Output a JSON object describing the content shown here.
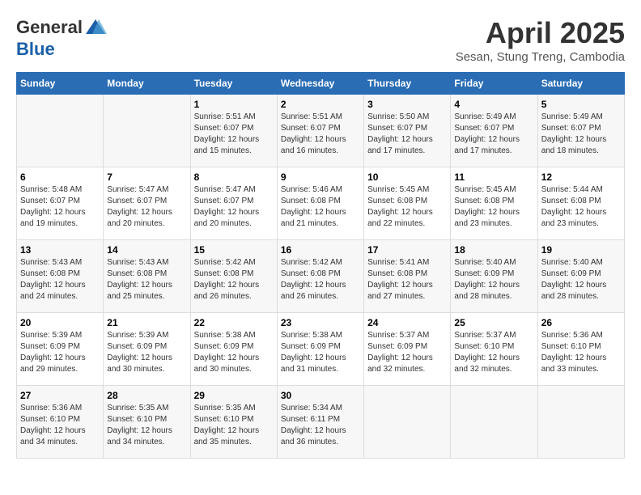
{
  "logo": {
    "general": "General",
    "blue": "Blue"
  },
  "title": "April 2025",
  "subtitle": "Sesan, Stung Treng, Cambodia",
  "days": [
    "Sunday",
    "Monday",
    "Tuesday",
    "Wednesday",
    "Thursday",
    "Friday",
    "Saturday"
  ],
  "weeks": [
    [
      {
        "day": "",
        "info": ""
      },
      {
        "day": "",
        "info": ""
      },
      {
        "day": "1",
        "info": "Sunrise: 5:51 AM\nSunset: 6:07 PM\nDaylight: 12 hours and 15 minutes."
      },
      {
        "day": "2",
        "info": "Sunrise: 5:51 AM\nSunset: 6:07 PM\nDaylight: 12 hours and 16 minutes."
      },
      {
        "day": "3",
        "info": "Sunrise: 5:50 AM\nSunset: 6:07 PM\nDaylight: 12 hours and 17 minutes."
      },
      {
        "day": "4",
        "info": "Sunrise: 5:49 AM\nSunset: 6:07 PM\nDaylight: 12 hours and 17 minutes."
      },
      {
        "day": "5",
        "info": "Sunrise: 5:49 AM\nSunset: 6:07 PM\nDaylight: 12 hours and 18 minutes."
      }
    ],
    [
      {
        "day": "6",
        "info": "Sunrise: 5:48 AM\nSunset: 6:07 PM\nDaylight: 12 hours and 19 minutes."
      },
      {
        "day": "7",
        "info": "Sunrise: 5:47 AM\nSunset: 6:07 PM\nDaylight: 12 hours and 20 minutes."
      },
      {
        "day": "8",
        "info": "Sunrise: 5:47 AM\nSunset: 6:07 PM\nDaylight: 12 hours and 20 minutes."
      },
      {
        "day": "9",
        "info": "Sunrise: 5:46 AM\nSunset: 6:08 PM\nDaylight: 12 hours and 21 minutes."
      },
      {
        "day": "10",
        "info": "Sunrise: 5:45 AM\nSunset: 6:08 PM\nDaylight: 12 hours and 22 minutes."
      },
      {
        "day": "11",
        "info": "Sunrise: 5:45 AM\nSunset: 6:08 PM\nDaylight: 12 hours and 23 minutes."
      },
      {
        "day": "12",
        "info": "Sunrise: 5:44 AM\nSunset: 6:08 PM\nDaylight: 12 hours and 23 minutes."
      }
    ],
    [
      {
        "day": "13",
        "info": "Sunrise: 5:43 AM\nSunset: 6:08 PM\nDaylight: 12 hours and 24 minutes."
      },
      {
        "day": "14",
        "info": "Sunrise: 5:43 AM\nSunset: 6:08 PM\nDaylight: 12 hours and 25 minutes."
      },
      {
        "day": "15",
        "info": "Sunrise: 5:42 AM\nSunset: 6:08 PM\nDaylight: 12 hours and 26 minutes."
      },
      {
        "day": "16",
        "info": "Sunrise: 5:42 AM\nSunset: 6:08 PM\nDaylight: 12 hours and 26 minutes."
      },
      {
        "day": "17",
        "info": "Sunrise: 5:41 AM\nSunset: 6:08 PM\nDaylight: 12 hours and 27 minutes."
      },
      {
        "day": "18",
        "info": "Sunrise: 5:40 AM\nSunset: 6:09 PM\nDaylight: 12 hours and 28 minutes."
      },
      {
        "day": "19",
        "info": "Sunrise: 5:40 AM\nSunset: 6:09 PM\nDaylight: 12 hours and 28 minutes."
      }
    ],
    [
      {
        "day": "20",
        "info": "Sunrise: 5:39 AM\nSunset: 6:09 PM\nDaylight: 12 hours and 29 minutes."
      },
      {
        "day": "21",
        "info": "Sunrise: 5:39 AM\nSunset: 6:09 PM\nDaylight: 12 hours and 30 minutes."
      },
      {
        "day": "22",
        "info": "Sunrise: 5:38 AM\nSunset: 6:09 PM\nDaylight: 12 hours and 30 minutes."
      },
      {
        "day": "23",
        "info": "Sunrise: 5:38 AM\nSunset: 6:09 PM\nDaylight: 12 hours and 31 minutes."
      },
      {
        "day": "24",
        "info": "Sunrise: 5:37 AM\nSunset: 6:09 PM\nDaylight: 12 hours and 32 minutes."
      },
      {
        "day": "25",
        "info": "Sunrise: 5:37 AM\nSunset: 6:10 PM\nDaylight: 12 hours and 32 minutes."
      },
      {
        "day": "26",
        "info": "Sunrise: 5:36 AM\nSunset: 6:10 PM\nDaylight: 12 hours and 33 minutes."
      }
    ],
    [
      {
        "day": "27",
        "info": "Sunrise: 5:36 AM\nSunset: 6:10 PM\nDaylight: 12 hours and 34 minutes."
      },
      {
        "day": "28",
        "info": "Sunrise: 5:35 AM\nSunset: 6:10 PM\nDaylight: 12 hours and 34 minutes."
      },
      {
        "day": "29",
        "info": "Sunrise: 5:35 AM\nSunset: 6:10 PM\nDaylight: 12 hours and 35 minutes."
      },
      {
        "day": "30",
        "info": "Sunrise: 5:34 AM\nSunset: 6:11 PM\nDaylight: 12 hours and 36 minutes."
      },
      {
        "day": "",
        "info": ""
      },
      {
        "day": "",
        "info": ""
      },
      {
        "day": "",
        "info": ""
      }
    ]
  ]
}
